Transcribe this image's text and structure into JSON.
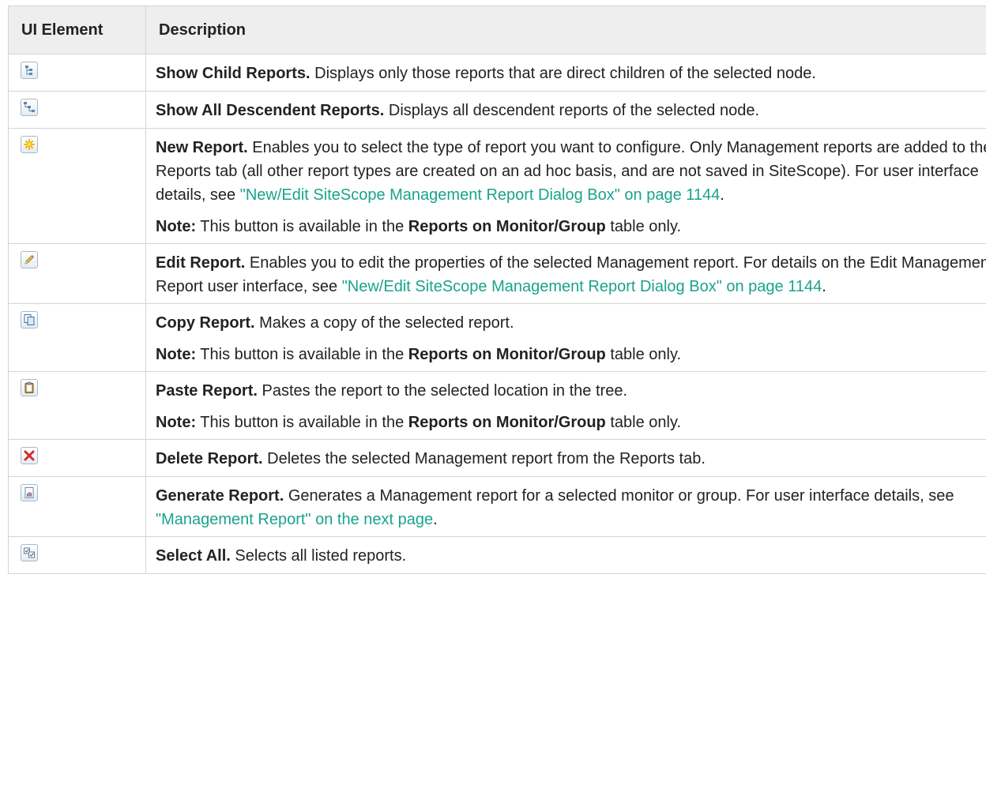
{
  "header": {
    "col1": "UI Element",
    "col2": "Description"
  },
  "rows": [
    {
      "icon": "show-child-reports-icon",
      "p1": {
        "title": "Show Child Reports.",
        "text": " Displays only those reports that are direct children of the selected node."
      }
    },
    {
      "icon": "show-all-descendent-reports-icon",
      "p1": {
        "title": "Show All Descendent Reports.",
        "text": " Displays all descendent reports of the selected node."
      }
    },
    {
      "icon": "new-report-icon",
      "p1": {
        "title": "New Report.",
        "text": " Enables you to select the type of report you want to configure. Only Management reports are added to the Reports tab (all other report types are created on an ad hoc basis, and are not saved in SiteScope). For user interface details, see ",
        "link": "\"New/Edit SiteScope Management Report Dialog Box\" on page 1144",
        "after": "."
      },
      "p2": {
        "label": "Note:",
        "text1": " This button is available in the ",
        "bold": "Reports on Monitor/Group",
        "text2": " table only."
      }
    },
    {
      "icon": "edit-report-icon",
      "p1": {
        "title": "Edit Report.",
        "text": " Enables you to edit the properties of the selected Management report. For details on the Edit Management Report user interface, see ",
        "link": "\"New/Edit SiteScope Management Report Dialog Box\" on page 1144",
        "after": "."
      }
    },
    {
      "icon": "copy-report-icon",
      "p1": {
        "title": "Copy Report.",
        "text": " Makes a copy of the selected report."
      },
      "p2": {
        "label": "Note:",
        "text1": " This button is available in the ",
        "bold": "Reports on Monitor/Group",
        "text2": " table only."
      }
    },
    {
      "icon": "paste-report-icon",
      "p1": {
        "title": "Paste Report.",
        "text": " Pastes the report to the selected location in the tree."
      },
      "p2": {
        "label": "Note:",
        "text1": " This button is available in the ",
        "bold": "Reports on Monitor/Group",
        "text2": " table only."
      }
    },
    {
      "icon": "delete-report-icon",
      "p1": {
        "title": "Delete Report.",
        "text": " Deletes the selected Management report from the Reports tab."
      }
    },
    {
      "icon": "generate-report-icon",
      "p1": {
        "title": "Generate Report.",
        "text": " Generates a Management report for a selected monitor or group. For user interface details, see ",
        "link": "\"Management Report\" on the next page",
        "after": "."
      }
    },
    {
      "icon": "select-all-icon",
      "p1": {
        "title": "Select All.",
        "text": " Selects all listed reports."
      }
    }
  ]
}
